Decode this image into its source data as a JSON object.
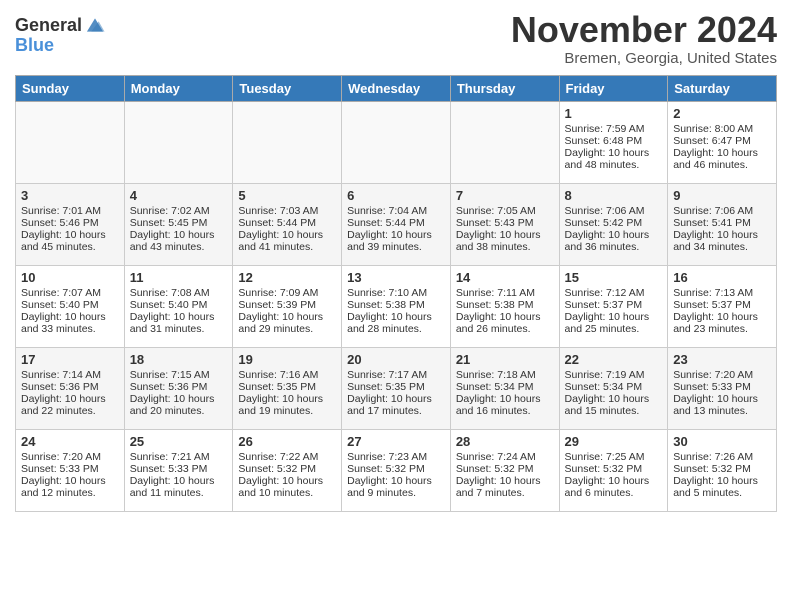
{
  "header": {
    "logo_general": "General",
    "logo_blue": "Blue",
    "month": "November 2024",
    "location": "Bremen, Georgia, United States"
  },
  "weekdays": [
    "Sunday",
    "Monday",
    "Tuesday",
    "Wednesday",
    "Thursday",
    "Friday",
    "Saturday"
  ],
  "weeks": [
    [
      {
        "day": "",
        "content": ""
      },
      {
        "day": "",
        "content": ""
      },
      {
        "day": "",
        "content": ""
      },
      {
        "day": "",
        "content": ""
      },
      {
        "day": "",
        "content": ""
      },
      {
        "day": "1",
        "content": "Sunrise: 7:59 AM\nSunset: 6:48 PM\nDaylight: 10 hours\nand 48 minutes."
      },
      {
        "day": "2",
        "content": "Sunrise: 8:00 AM\nSunset: 6:47 PM\nDaylight: 10 hours\nand 46 minutes."
      }
    ],
    [
      {
        "day": "3",
        "content": "Sunrise: 7:01 AM\nSunset: 5:46 PM\nDaylight: 10 hours\nand 45 minutes."
      },
      {
        "day": "4",
        "content": "Sunrise: 7:02 AM\nSunset: 5:45 PM\nDaylight: 10 hours\nand 43 minutes."
      },
      {
        "day": "5",
        "content": "Sunrise: 7:03 AM\nSunset: 5:44 PM\nDaylight: 10 hours\nand 41 minutes."
      },
      {
        "day": "6",
        "content": "Sunrise: 7:04 AM\nSunset: 5:44 PM\nDaylight: 10 hours\nand 39 minutes."
      },
      {
        "day": "7",
        "content": "Sunrise: 7:05 AM\nSunset: 5:43 PM\nDaylight: 10 hours\nand 38 minutes."
      },
      {
        "day": "8",
        "content": "Sunrise: 7:06 AM\nSunset: 5:42 PM\nDaylight: 10 hours\nand 36 minutes."
      },
      {
        "day": "9",
        "content": "Sunrise: 7:06 AM\nSunset: 5:41 PM\nDaylight: 10 hours\nand 34 minutes."
      }
    ],
    [
      {
        "day": "10",
        "content": "Sunrise: 7:07 AM\nSunset: 5:40 PM\nDaylight: 10 hours\nand 33 minutes."
      },
      {
        "day": "11",
        "content": "Sunrise: 7:08 AM\nSunset: 5:40 PM\nDaylight: 10 hours\nand 31 minutes."
      },
      {
        "day": "12",
        "content": "Sunrise: 7:09 AM\nSunset: 5:39 PM\nDaylight: 10 hours\nand 29 minutes."
      },
      {
        "day": "13",
        "content": "Sunrise: 7:10 AM\nSunset: 5:38 PM\nDaylight: 10 hours\nand 28 minutes."
      },
      {
        "day": "14",
        "content": "Sunrise: 7:11 AM\nSunset: 5:38 PM\nDaylight: 10 hours\nand 26 minutes."
      },
      {
        "day": "15",
        "content": "Sunrise: 7:12 AM\nSunset: 5:37 PM\nDaylight: 10 hours\nand 25 minutes."
      },
      {
        "day": "16",
        "content": "Sunrise: 7:13 AM\nSunset: 5:37 PM\nDaylight: 10 hours\nand 23 minutes."
      }
    ],
    [
      {
        "day": "17",
        "content": "Sunrise: 7:14 AM\nSunset: 5:36 PM\nDaylight: 10 hours\nand 22 minutes."
      },
      {
        "day": "18",
        "content": "Sunrise: 7:15 AM\nSunset: 5:36 PM\nDaylight: 10 hours\nand 20 minutes."
      },
      {
        "day": "19",
        "content": "Sunrise: 7:16 AM\nSunset: 5:35 PM\nDaylight: 10 hours\nand 19 minutes."
      },
      {
        "day": "20",
        "content": "Sunrise: 7:17 AM\nSunset: 5:35 PM\nDaylight: 10 hours\nand 17 minutes."
      },
      {
        "day": "21",
        "content": "Sunrise: 7:18 AM\nSunset: 5:34 PM\nDaylight: 10 hours\nand 16 minutes."
      },
      {
        "day": "22",
        "content": "Sunrise: 7:19 AM\nSunset: 5:34 PM\nDaylight: 10 hours\nand 15 minutes."
      },
      {
        "day": "23",
        "content": "Sunrise: 7:20 AM\nSunset: 5:33 PM\nDaylight: 10 hours\nand 13 minutes."
      }
    ],
    [
      {
        "day": "24",
        "content": "Sunrise: 7:20 AM\nSunset: 5:33 PM\nDaylight: 10 hours\nand 12 minutes."
      },
      {
        "day": "25",
        "content": "Sunrise: 7:21 AM\nSunset: 5:33 PM\nDaylight: 10 hours\nand 11 minutes."
      },
      {
        "day": "26",
        "content": "Sunrise: 7:22 AM\nSunset: 5:32 PM\nDaylight: 10 hours\nand 10 minutes."
      },
      {
        "day": "27",
        "content": "Sunrise: 7:23 AM\nSunset: 5:32 PM\nDaylight: 10 hours\nand 9 minutes."
      },
      {
        "day": "28",
        "content": "Sunrise: 7:24 AM\nSunset: 5:32 PM\nDaylight: 10 hours\nand 7 minutes."
      },
      {
        "day": "29",
        "content": "Sunrise: 7:25 AM\nSunset: 5:32 PM\nDaylight: 10 hours\nand 6 minutes."
      },
      {
        "day": "30",
        "content": "Sunrise: 7:26 AM\nSunset: 5:32 PM\nDaylight: 10 hours\nand 5 minutes."
      }
    ]
  ]
}
